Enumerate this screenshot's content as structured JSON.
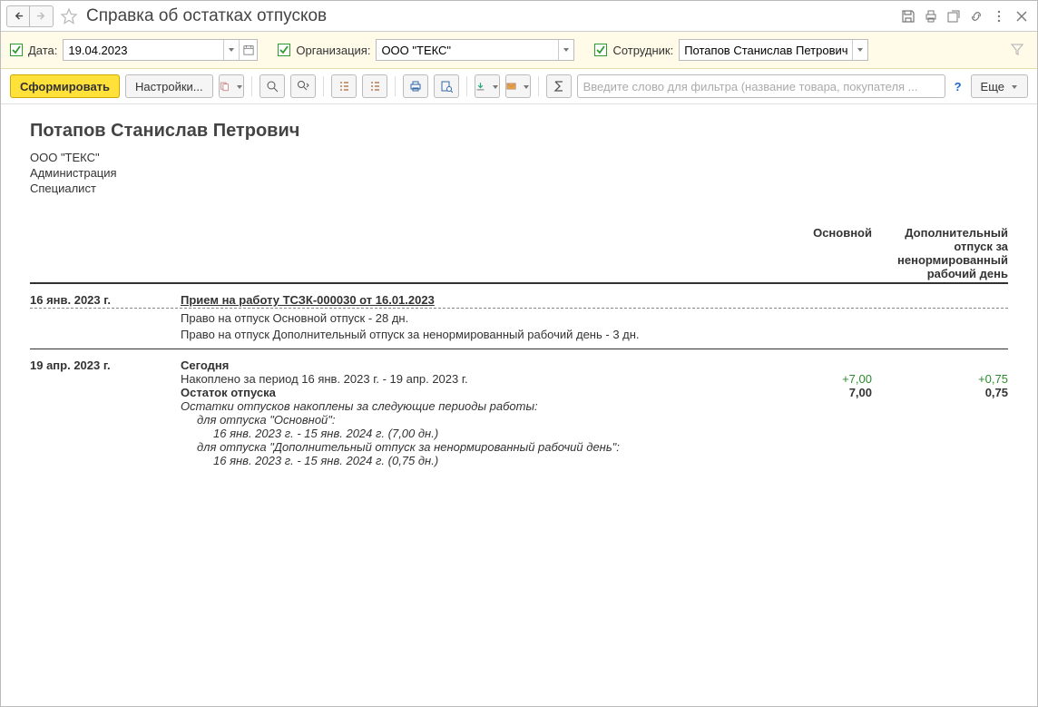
{
  "title": "Справка об остатках отпусков",
  "filters": {
    "date": {
      "label": "Дата:",
      "value": "19.04.2023"
    },
    "org": {
      "label": "Организация:",
      "value": "ООО \"ТЕКС\""
    },
    "emp": {
      "label": "Сотрудник:",
      "value": "Потапов Станислав Петрович"
    }
  },
  "toolbar": {
    "run": "Сформировать",
    "settings": "Настройки...",
    "more": "Еще",
    "filter_placeholder": "Введите слово для фильтра (название товара, покупателя ...",
    "help": "?"
  },
  "report": {
    "employee": "Потапов Станислав Петрович",
    "org": "ООО \"ТЕКС\"",
    "dept": "Администрация",
    "post": "Специалист",
    "col_main": "Основной",
    "col_extra": "Дополнительный отпуск за ненормированный рабочий день",
    "hire": {
      "date": "16 янв. 2023 г.",
      "doc": "Прием на работу ТСЗК-000030 от 16.01.2023",
      "line1": "Право на отпуск Основной отпуск - 28 дн.",
      "line2": "Право на отпуск Дополнительный отпуск за ненормированный рабочий день - 3 дн."
    },
    "today": {
      "date": "19 апр. 2023 г.",
      "today_label": "Сегодня",
      "accrued_label": "Накоплено за период 16 янв. 2023 г. - 19 апр. 2023 г.",
      "accrued_v1": "+7,00",
      "accrued_v2": "+0,75",
      "balance_label": "Остаток отпуска",
      "balance_v1": "7,00",
      "balance_v2": "0,75",
      "periods_head": "Остатки отпусков накоплены за следующие периоды работы:",
      "period_main_label": "для отпуска \"Основной\":",
      "period_main_range": "16 янв. 2023 г. - 15 янв. 2024 г. (7,00 дн.)",
      "period_extra_label": "для отпуска \"Дополнительный отпуск за ненормированный рабочий день\":",
      "period_extra_range": "16 янв. 2023 г. - 15 янв. 2024 г. (0,75 дн.)"
    }
  }
}
